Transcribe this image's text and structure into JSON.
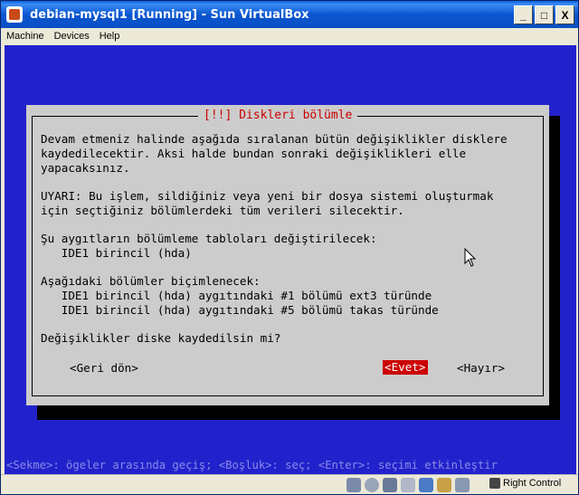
{
  "window": {
    "title": "debian-mysql1 [Running] - Sun VirtualBox",
    "controls": {
      "minimize": "_",
      "maximize": "□",
      "close": "X"
    }
  },
  "menubar": {
    "items": [
      "Machine",
      "Devices",
      "Help"
    ]
  },
  "dialog": {
    "title": "[!!] Diskleri bölümle",
    "lines": [
      "Devam etmeniz halinde aşağıda sıralanan bütün değişiklikler disklere",
      "kaydedilecektir. Aksi halde bundan sonraki değişiklikleri elle",
      "yapacaksınız.",
      "",
      "UYARI: Bu işlem, sildiğiniz veya yeni bir dosya sistemi oluşturmak",
      "için seçtiğiniz bölümlerdeki tüm verileri silecektir.",
      "",
      "Şu aygıtların bölümleme tabloları değiştirilecek:",
      "   IDE1 birincil (hda)",
      "",
      "Aşağıdaki bölümler biçimlenecek:",
      "   IDE1 birincil (hda) aygıtındaki #1 bölümü ext3 türünde",
      "   IDE1 birincil (hda) aygıtındaki #5 bölümü takas türünde",
      "",
      "Değişiklikler diske kaydedilsin mi?"
    ],
    "buttons": {
      "back": "<Geri dön>",
      "yes": "<Evet>",
      "no": "<Hayır>"
    }
  },
  "statusline": "<Sekme>: ögeler arasında geçiş; <Boşluk>: seç; <Enter>: seçimi etkinleştir",
  "vbox_status": {
    "host_key": "Right Control"
  },
  "colors": {
    "screen_bg": "#2222cc",
    "dialog_bg": "#cccccc",
    "title_red": "#cc0000"
  }
}
